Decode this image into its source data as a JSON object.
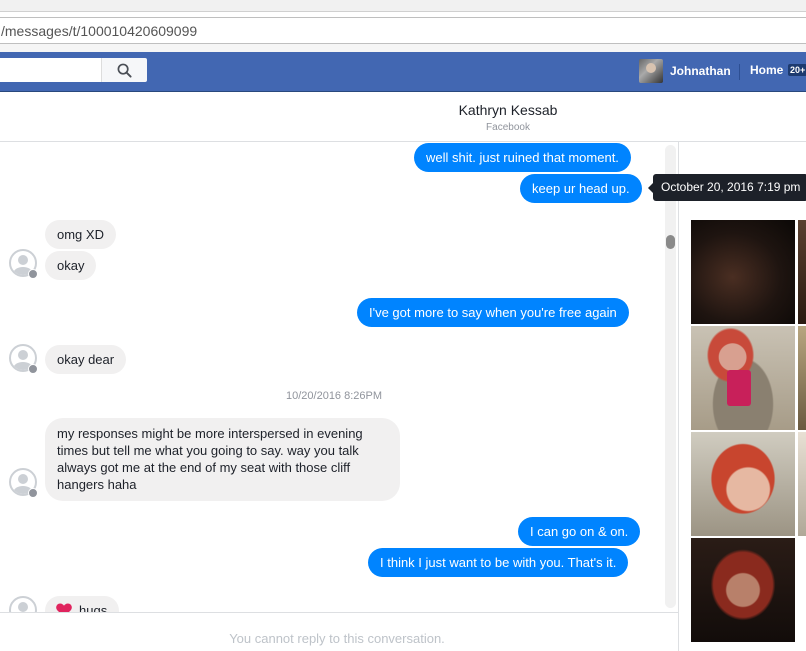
{
  "browser": {
    "url": "/messages/t/100010420609099"
  },
  "fb_bar": {
    "user_name": "Johnathan",
    "home_label": "Home",
    "home_badge": "20+"
  },
  "conversation": {
    "name": "Kathryn Kessab",
    "source": "Facebook"
  },
  "messages": [
    {
      "dir": "out",
      "text": "well shit. just ruined that moment."
    },
    {
      "dir": "out",
      "text": "keep ur head up."
    },
    {
      "dir": "in",
      "text": "omg XD"
    },
    {
      "dir": "in",
      "text": "okay"
    },
    {
      "dir": "out",
      "text": "I've got more to say when you're free again"
    },
    {
      "dir": "in",
      "text": "okay dear"
    },
    {
      "dir": "in",
      "text": "my responses might be more interspersed in evening times but tell me what you going to say. way you talk always got me at the end of my seat with those  cliff hangers haha"
    },
    {
      "dir": "out",
      "text": "I can go on & on."
    },
    {
      "dir": "out",
      "text": "I think I just want to be with you. That's it."
    },
    {
      "dir": "in",
      "text": "hugs"
    }
  ],
  "timestamp_separator": "10/20/2016 8:26PM",
  "tooltip": "October 20, 2016 7:19 pm",
  "footer": {
    "notice": "You cannot reply to this conversation."
  },
  "icons": {
    "search": "search-icon",
    "avatar_placeholder": "default-avatar-icon",
    "heart": "heart-icon"
  },
  "colors": {
    "fb_blue": "#4267b2",
    "outgoing_bubble": "#0084ff",
    "incoming_bubble": "#f1f0f0"
  }
}
